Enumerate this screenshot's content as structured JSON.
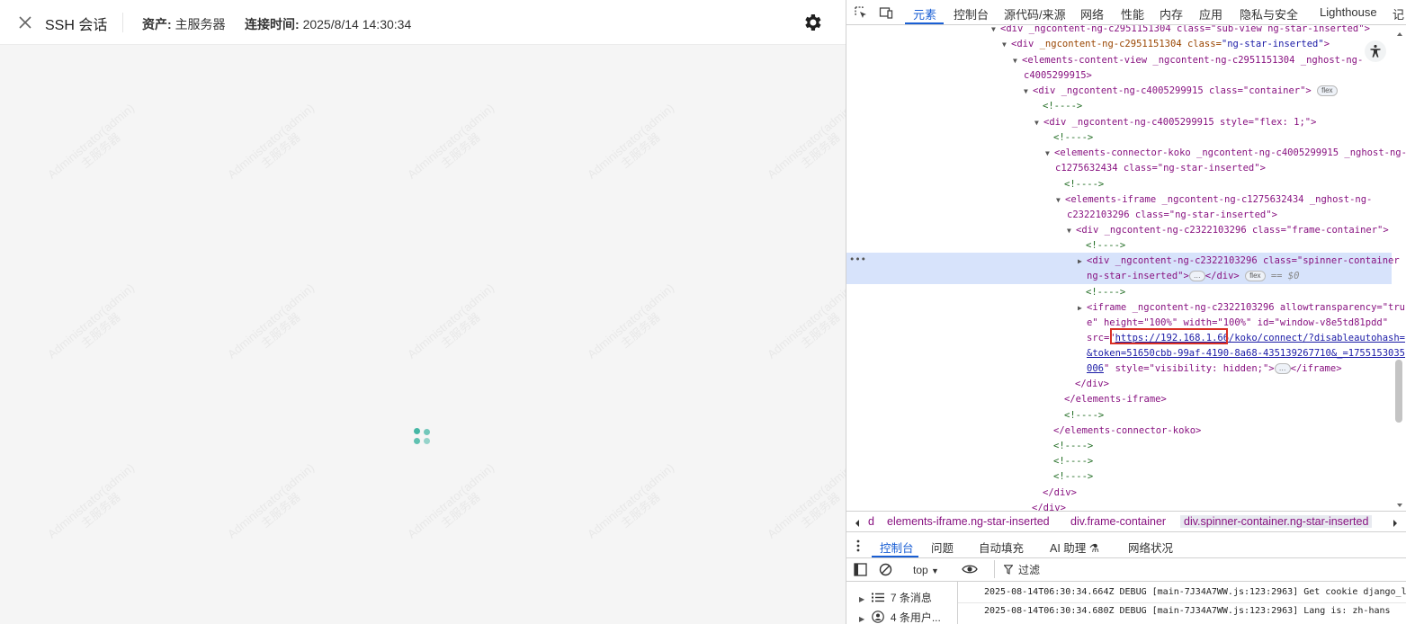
{
  "app": {
    "title": "SSH 会话",
    "asset_label": "资产:",
    "asset_value": "主服务器",
    "conn_label": "连接时间:",
    "conn_value": "2025/8/14 14:30:34",
    "watermark_user": "Administrator(admin)",
    "watermark_org": "主服务器",
    "spinner_color": "#45b7a5"
  },
  "devtools": {
    "tabs": [
      "元素",
      "控制台",
      "源代码/来源",
      "网络",
      "性能",
      "内存",
      "应用",
      "隐私与安全",
      "Lighthouse",
      "记"
    ],
    "active_tab": "元素",
    "dom": {
      "l1": "<div _ngcontent-ng-c2951151304 class=\"sub-view ng-star-inserted\">",
      "l2_tag": "<div ",
      "l2_attr": "_ngcontent-ng-c2951151304 class=",
      "l2_val": "\"ng-star-inserted\"",
      "l3a": "<elements-content-view _ngcontent-ng-c2951151304 _nghost-ng-",
      "l3b": "c4005299915>",
      "l4": "<div _ngcontent-ng-c4005299915 class=\"container\">",
      "l4_pill": "flex",
      "c1": "<!---->",
      "l5": "<div _ngcontent-ng-c4005299915 style=\"flex: 1;\">",
      "l6a": "<elements-connector-koko _ngcontent-ng-c4005299915 _nghost-ng-",
      "l6b": "c1275632434 class=\"ng-star-inserted\">",
      "l7a": "<elements-iframe _ngcontent-ng-c1275632434 _nghost-ng-",
      "l7b": "c2322103296 class=\"ng-star-inserted\">",
      "l8": "<div _ngcontent-ng-c2322103296 class=\"frame-container\">",
      "sel_a": "<div _ngcontent-ng-c2322103296 class=\"spinner-container",
      "sel_b": "ng-star-inserted\">",
      "sel_ellipsis": "…",
      "sel_close": "</div>",
      "sel_pill": "flex",
      "sel_dollar": "== $0",
      "if_a": "<iframe _ngcontent-ng-c2322103296 allowtransparency=\"tru",
      "if_b": "e\" height=\"100%\" width=\"100%\" id=\"window-v8e5td81pdd\"",
      "if_c_pre": "src=\"",
      "if_c_link": "https://192.168.1.66/koko/connect/?disableautohash=",
      "if_d_link": "&token=51650cbb-99af-4190-8a68-435139267710&_=1755153035",
      "if_e_link": "006",
      "if_e_post": "\" style=\"visibility: hidden;\">",
      "if_e_ellipsis": "…",
      "if_e_close": "</iframe>",
      "close_div": "</div>",
      "close_iframe": "</elements-iframe>",
      "close_koko": "</elements-connector-koko>",
      "row_marker": "•••"
    },
    "breadcrumbs": [
      "d",
      "elements-iframe.ng-star-inserted",
      "div.frame-container",
      "div.spinner-container.ng-star-inserted"
    ],
    "drawer_tabs": [
      "控制台",
      "问题",
      "自动填充",
      "AI 助理 ⚗",
      "网络状况"
    ],
    "console_context": "top",
    "filter_label": "过滤",
    "sidebar": [
      "7 条消息",
      "4 条用户..."
    ],
    "logs": [
      "2025-08-14T06:30:34.664Z DEBUG [main-7J34A7WW.js:123:2963] Get cookie django_l",
      "2025-08-14T06:30:34.680Z DEBUG [main-7J34A7WW.js:123:2963] Lang is:  zh-hans"
    ]
  }
}
